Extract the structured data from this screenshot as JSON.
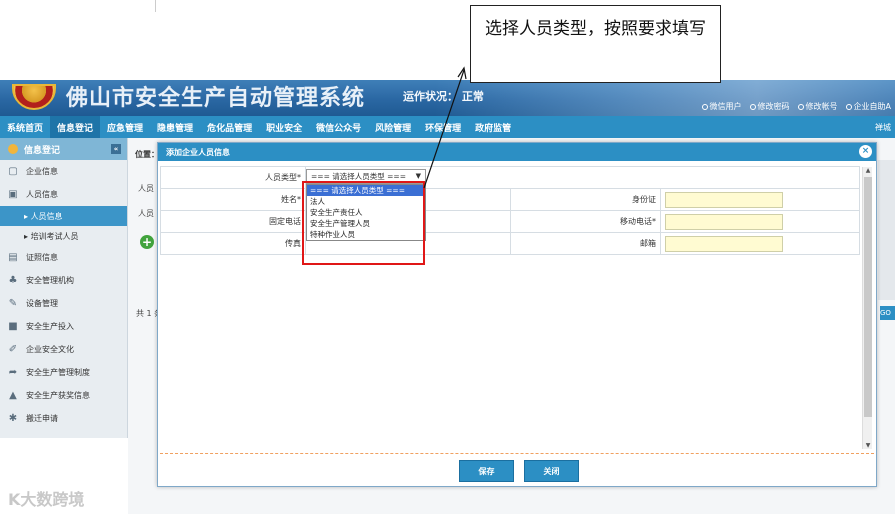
{
  "annotation": {
    "text": "选择人员类型，按照要求填写"
  },
  "header": {
    "title": "佛山市安全生产自动管理系统",
    "status": "运作状况： 正常",
    "links": [
      "微信用户",
      "修改密码",
      "修改帐号",
      "企业自助A"
    ]
  },
  "nav": {
    "items": [
      "系统首页",
      "信息登记",
      "应急管理",
      "隐患管理",
      "危化品管理",
      "职业安全",
      "微信公众号",
      "风险管理",
      "环保管理",
      "政府监管"
    ],
    "right": "禅城"
  },
  "sidebar": {
    "header": "信息登记",
    "collapse": "«",
    "items": [
      {
        "label": "企业信息",
        "icon": "▢"
      },
      {
        "label": "人员信息",
        "icon": "▣"
      },
      {
        "sub": "人员信息",
        "active": true
      },
      {
        "sub": "培训考试人员"
      },
      {
        "label": "证照信息",
        "icon": "▤"
      },
      {
        "label": "安全管理机构",
        "icon": "♣"
      },
      {
        "label": "设备管理",
        "icon": "✎"
      },
      {
        "label": "安全生产投入",
        "icon": "■"
      },
      {
        "label": "企业安全文化",
        "icon": "✐"
      },
      {
        "label": "安全生产管理制度",
        "icon": "➦"
      },
      {
        "label": "安全生产获奖信息",
        "icon": "▲"
      },
      {
        "label": "搬迁申请",
        "icon": "✱"
      }
    ]
  },
  "background": {
    "crumb": "位置：",
    "label1": "人员",
    "label2": "人员",
    "count": "共 1 条",
    "right_btn": "GO"
  },
  "modal": {
    "title": "添加企业人员信息",
    "close": "×",
    "fields": {
      "person_type_label": "人员类型*",
      "name_label": "姓名*",
      "id_label": "身份证",
      "phone_label": "固定电话",
      "mobile_label": "移动电话*",
      "fax_label": "传真",
      "email_label": "邮箱"
    },
    "select": {
      "value": "=== 请选择人员类型 ===",
      "options": [
        "=== 请选择人员类型 ===",
        "法人",
        "安全生产责任人",
        "安全生产管理人员",
        "特种作业人员"
      ]
    },
    "save_label": "保存",
    "close_label": "关闭"
  },
  "watermark": "K大数跨境"
}
